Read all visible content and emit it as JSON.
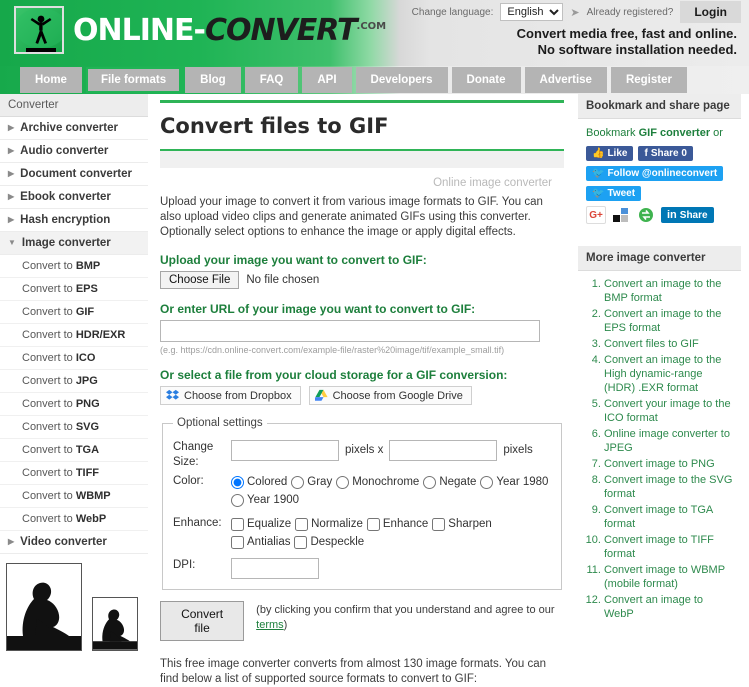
{
  "header": {
    "logo_text_white": "ONLINE-",
    "logo_text_dark": "CONVERT",
    "logo_com": ".COM",
    "change_language_label": "Change language:",
    "language_value": "English",
    "language_options": [
      "English"
    ],
    "go_arrow": "➤",
    "already_registered": "Already registered?",
    "login_label": "Login",
    "tagline_line1": "Convert media free, fast and online.",
    "tagline_line2": "No software installation needed."
  },
  "nav": {
    "items": [
      {
        "label": "Home",
        "active": false
      },
      {
        "label": "File formats",
        "active": true
      },
      {
        "label": "Blog",
        "active": false
      },
      {
        "label": "FAQ",
        "active": false
      },
      {
        "label": "API",
        "active": false
      },
      {
        "label": "Developers",
        "active": false
      },
      {
        "label": "Donate",
        "active": false
      },
      {
        "label": "Advertise",
        "active": false
      },
      {
        "label": "Register",
        "active": false
      }
    ]
  },
  "sidebar": {
    "title": "Converter",
    "categories": [
      {
        "label": "Archive converter",
        "expanded": false
      },
      {
        "label": "Audio converter",
        "expanded": false
      },
      {
        "label": "Document converter",
        "expanded": false
      },
      {
        "label": "Ebook converter",
        "expanded": false
      },
      {
        "label": "Hash encryption",
        "expanded": false
      },
      {
        "label": "Image converter",
        "expanded": true
      },
      {
        "label": "Video converter",
        "expanded": false
      }
    ],
    "image_items": [
      {
        "prefix": "Convert to ",
        "format": "BMP"
      },
      {
        "prefix": "Convert to ",
        "format": "EPS"
      },
      {
        "prefix": "Convert to ",
        "format": "GIF"
      },
      {
        "prefix": "Convert to ",
        "format": "HDR/EXR"
      },
      {
        "prefix": "Convert to ",
        "format": "ICO"
      },
      {
        "prefix": "Convert to ",
        "format": "JPG"
      },
      {
        "prefix": "Convert to ",
        "format": "PNG"
      },
      {
        "prefix": "Convert to ",
        "format": "SVG"
      },
      {
        "prefix": "Convert to ",
        "format": "TGA"
      },
      {
        "prefix": "Convert to ",
        "format": "TIFF"
      },
      {
        "prefix": "Convert to ",
        "format": "WBMP"
      },
      {
        "prefix": "Convert to ",
        "format": "WebP"
      }
    ]
  },
  "main": {
    "page_title": "Convert files to GIF",
    "watermark": "Online image converter",
    "description": "Upload your image to convert it from various image formats to GIF. You can also upload video clips and generate animated GIFs using this converter. Optionally select options to enhance the image or apply digital effects.",
    "upload_label": "Upload your image you want to convert to GIF:",
    "choose_file_label": "Choose File",
    "no_file_chosen": "No file chosen",
    "url_label": "Or enter URL of your image you want to convert to GIF:",
    "url_value": "",
    "url_hint": "(e.g. https://cdn.online-convert.com/example-file/raster%20image/tif/example_small.tif)",
    "cloud_label": "Or select a file from your cloud storage for a GIF conversion:",
    "dropbox_label": "Choose from Dropbox",
    "gdrive_label": "Choose from Google Drive",
    "settings": {
      "legend": "Optional settings",
      "change_size_label": "Change Size:",
      "width_value": "",
      "height_value": "",
      "pixels_x_label": "pixels x",
      "pixels_label": "pixels",
      "color_label": "Color:",
      "color_options": [
        {
          "label": "Colored",
          "checked": true
        },
        {
          "label": "Gray",
          "checked": false
        },
        {
          "label": "Monochrome",
          "checked": false
        },
        {
          "label": "Negate",
          "checked": false
        },
        {
          "label": "Year 1980",
          "checked": false
        },
        {
          "label": "Year 1900",
          "checked": false
        }
      ],
      "enhance_label": "Enhance:",
      "enhance_options": [
        {
          "label": "Equalize",
          "checked": false
        },
        {
          "label": "Normalize",
          "checked": false
        },
        {
          "label": "Enhance",
          "checked": false
        },
        {
          "label": "Sharpen",
          "checked": false
        },
        {
          "label": "Antialias",
          "checked": false
        },
        {
          "label": "Despeckle",
          "checked": false
        }
      ],
      "dpi_label": "DPI:",
      "dpi_value": ""
    },
    "convert_button_label": "Convert file",
    "convert_note_1": "(by clicking you confirm that you understand and agree to our ",
    "convert_note_terms": "terms",
    "convert_note_2": ")",
    "footer_para": "This free image converter converts from almost 130 image formats. You can find below a list of supported source formats to convert to GIF:"
  },
  "right": {
    "bookmark_title": "Bookmark and share page",
    "bookmark_line_pre": "Bookmark ",
    "bookmark_line_bold": "GIF converter",
    "bookmark_line_post": " or",
    "like_label": "Like",
    "fb_share_label": "Share 0",
    "follow_label": "Follow @onlineconvert",
    "tweet_label": "Tweet",
    "gplus_label": "G+",
    "linkedin_label": "Share",
    "more_title": "More image converter",
    "more_items": [
      "Convert an image to the BMP format",
      "Convert an image to the EPS format",
      "Convert files to GIF",
      "Convert an image to the High dynamic-range (HDR) .EXR format",
      "Convert your image to the ICO format",
      "Online image converter to JPEG",
      "Convert image to PNG",
      "Convert image to the SVG format",
      "Convert image to TGA format",
      "Convert image to TIFF format",
      "Convert image to WBMP (mobile format)",
      "Convert an image to WebP"
    ]
  },
  "colors": {
    "brand_green": "#20b455",
    "link_green": "#2e8a4d",
    "label_green": "#1d7f3c",
    "nav_grey": "#b4b4b4"
  }
}
